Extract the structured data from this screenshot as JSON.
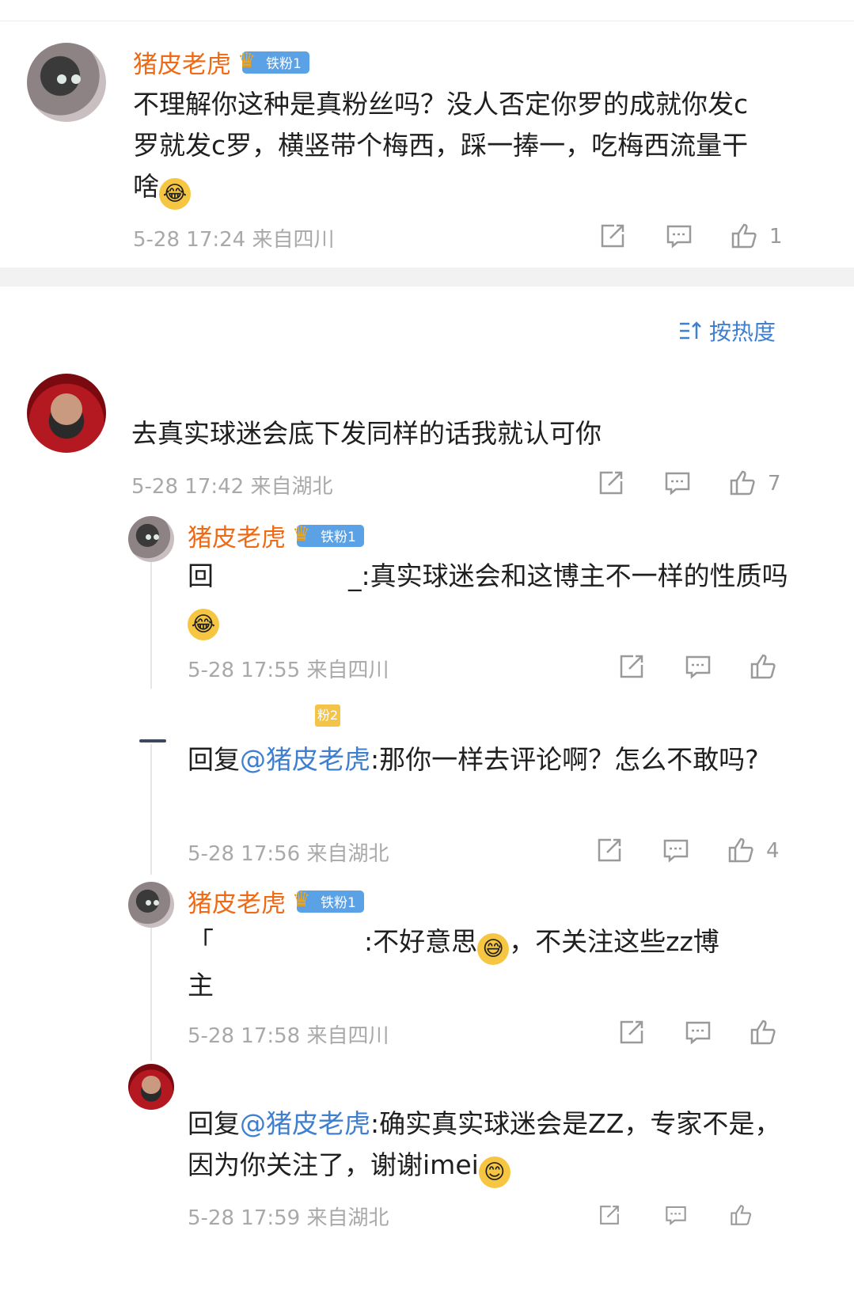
{
  "c1": {
    "username": "猪皮老虎",
    "badge": "铁粉1",
    "text": "不理解你这种是真粉丝吗？没人否定你罗的成就你发c罗就发c罗，横竖带个梅西，踩一捧一，吃梅西流量干啥",
    "meta": "5-28 17:24 来自四川",
    "likes": "1"
  },
  "sort_label": "按热度",
  "c2": {
    "text": "去真实球迷会底下发同样的话我就认可你",
    "meta": "5-28 17:42 来自湖北",
    "likes": "7"
  },
  "r1": {
    "username": "猪皮老虎",
    "badge": "铁粉1",
    "prefix": "回",
    "text": "_:真实球迷会和这博主不一样的性质吗",
    "meta": "5-28 17:55 来自四川"
  },
  "r2": {
    "badge_partial": "粉2",
    "prefix": "回复",
    "mention": "@猪皮老虎",
    "text": ":那你一样去评论啊？怎么不敢吗?",
    "meta": "5-28 17:56 来自湖北",
    "likes": "4"
  },
  "r3": {
    "username": "猪皮老虎",
    "badge": "铁粉1",
    "prefix": "「",
    "text1": ":不好意思",
    "text2": "，不关注这些zz博",
    "text3": "主",
    "meta": "5-28 17:58 来自四川"
  },
  "r4": {
    "prefix": "回复",
    "mention": "@猪皮老虎",
    "text": ":确实真实球迷会是ZZ，专家不是，因为你关注了，谢谢imei",
    "meta": "5-28 17:59 来自湖北"
  }
}
